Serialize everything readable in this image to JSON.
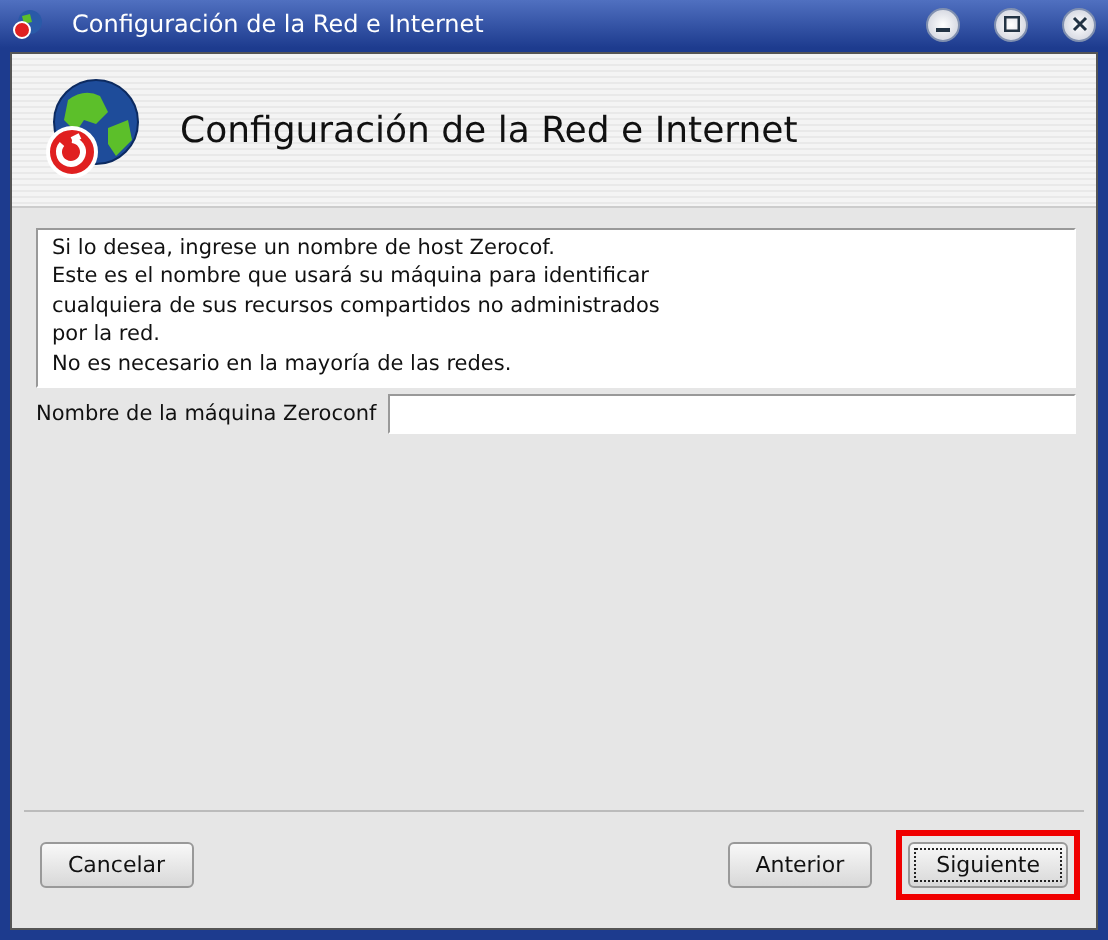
{
  "window": {
    "title": "Configuración de la Red e Internet"
  },
  "header": {
    "title": "Configuración de la Red e Internet"
  },
  "description": "Si lo desea, ingrese un nombre de host Zerocof.\nEste es el nombre que usará su máquina para identificar\ncualquiera de sus recursos compartidos no administrados\npor la red.\nNo es necesario en la mayoría de las redes.",
  "field": {
    "label": "Nombre de la máquina Zeroconf"
  },
  "buttons": [
    {
      "label": "Cancelar",
      "kind": "left",
      "focused": false,
      "highlighted": false
    },
    {
      "label": "Anterior",
      "kind": "right",
      "focused": false,
      "highlighted": false
    },
    {
      "label": "Siguiente",
      "kind": "right",
      "focused": true,
      "highlighted": true
    }
  ]
}
